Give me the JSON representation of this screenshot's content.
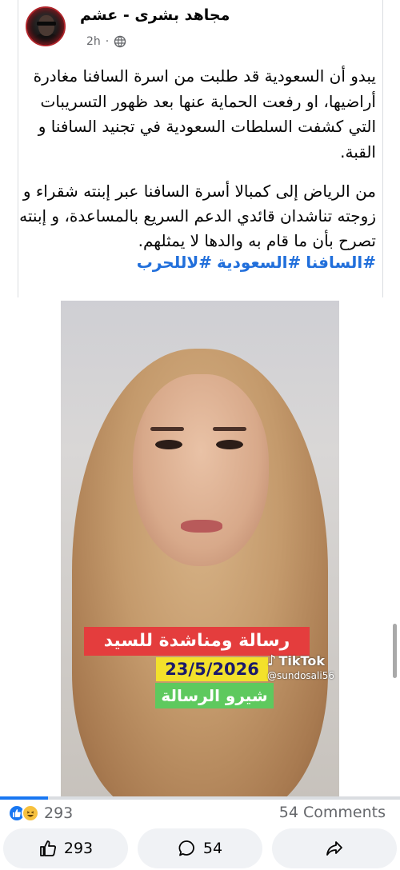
{
  "post": {
    "author": "مجاهد بشرى - عشم",
    "time": "2h",
    "privacy_icon": "globe-icon",
    "paragraph1": "يبدو أن السعودية قد طلبت من اسرة السافنا مغادرة أراضيها، او رفعت الحماية عنها بعد ظهور التسريبات التي كشفت السلطات السعودية في تجنيد السافنا و القبة.",
    "paragraph2": "من الرياض إلى كمبالا أسرة السافنا عبر إبنته شقراء و زوجته تناشدان قائدي الدعم السريع بالمساعدة، و إبنته تصرح بأن ما قام به والدها لا يمثلهم.",
    "hashtags": [
      "#السافنا",
      "#السعودية",
      "#لاللحرب"
    ]
  },
  "video": {
    "banner_red": "رسالة ومناشدة للسيد القائد",
    "banner_date": "23/5/2026",
    "banner_green": "شيرو الرسالة",
    "tiktok_label": "TikTok",
    "tiktok_user": "@sundosali56",
    "sound_icon": "speaker-icon",
    "progress": 0.12
  },
  "stats": {
    "reaction_count": "293",
    "comments": "54 Comments"
  },
  "actions": {
    "like_count": "293",
    "comment_count": "54"
  },
  "colors": {
    "link": "#216fdb",
    "accent": "#1877f2",
    "banner_red": "#e43d3d",
    "banner_yellow": "#f3e12b",
    "banner_green": "#5ec95e"
  }
}
